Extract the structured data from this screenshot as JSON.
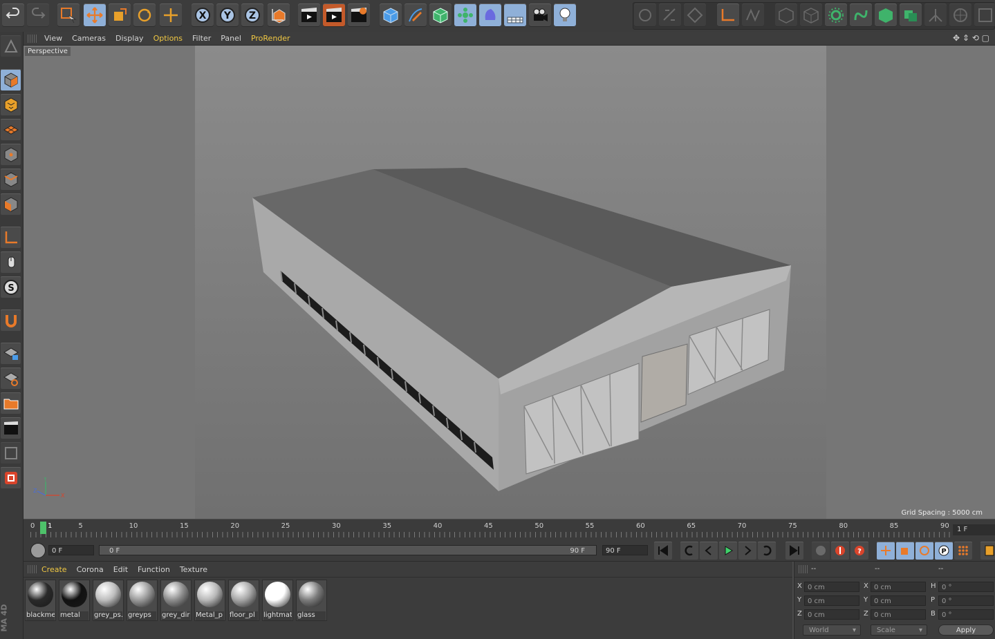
{
  "viewport_menu": [
    "View",
    "Cameras",
    "Display",
    "Options",
    "Filter",
    "Panel",
    "ProRender"
  ],
  "viewport_menu_highlight": [
    "Options",
    "ProRender"
  ],
  "viewport": {
    "camera_label": "Perspective",
    "grid_spacing": "Grid Spacing : 5000 cm",
    "axis": {
      "x": "X",
      "y": "Y",
      "z": "Z"
    }
  },
  "top_icons": [
    "undo-icon",
    "redo-icon",
    "live-selection-icon",
    "move-icon",
    "scale-icon",
    "rotate-icon",
    "last-tool-icon",
    "x-axis-lock-icon",
    "y-axis-lock-icon",
    "z-axis-lock-icon",
    "coordinate-system-icon",
    "render-view-icon",
    "render-picture-viewer-icon",
    "render-settings-icon",
    "cube-icon",
    "pen-spline-icon",
    "subdivision-icon",
    "array-icon",
    "deformer-icon",
    "floor-icon",
    "camera-icon",
    "light-icon"
  ],
  "timeline": {
    "ticks": [
      "0",
      "5",
      "10",
      "15",
      "20",
      "25",
      "30",
      "35",
      "40",
      "45",
      "50",
      "55",
      "60",
      "65",
      "70",
      "75",
      "80",
      "85",
      "90"
    ],
    "current_marker": "1",
    "current_frame_box": "1 F"
  },
  "transport": {
    "start_field": "0 F",
    "range_start": "0 F",
    "range_end": "90 F",
    "end_field": "90 F"
  },
  "material_menu": [
    "Create",
    "Corona",
    "Edit",
    "Function",
    "Texture"
  ],
  "material_menu_highlight": "Create",
  "materials": [
    {
      "name": "blackme",
      "color": "#2a2a2a"
    },
    {
      "name": "metal",
      "color": "#111111"
    },
    {
      "name": "grey_ps.",
      "color": "#bdbdbd"
    },
    {
      "name": "greyps",
      "color": "#9a9a9a"
    },
    {
      "name": "grey_dir",
      "color": "#8d8d8d"
    },
    {
      "name": "Metal_p",
      "color": "#b8b8b8"
    },
    {
      "name": "floor_pl",
      "color": "#a6a6a6"
    },
    {
      "name": "lightmat",
      "color": "#ffffff"
    },
    {
      "name": "glass",
      "color": "#7c7c7c"
    }
  ],
  "coords": {
    "headers": [
      "--",
      "--",
      "--"
    ],
    "rows": [
      {
        "l1": "X",
        "v1": "0 cm",
        "l2": "X",
        "v2": "0 cm",
        "l3": "H",
        "v3": "0 °"
      },
      {
        "l1": "Y",
        "v1": "0 cm",
        "l2": "Y",
        "v2": "0 cm",
        "l3": "P",
        "v3": "0 °"
      },
      {
        "l1": "Z",
        "v1": "0 cm",
        "l2": "Z",
        "v2": "0 cm",
        "l3": "B",
        "v3": "0 °"
      }
    ],
    "mode": "World",
    "type": "Scale",
    "apply": "Apply"
  },
  "brand": "MA 4D"
}
